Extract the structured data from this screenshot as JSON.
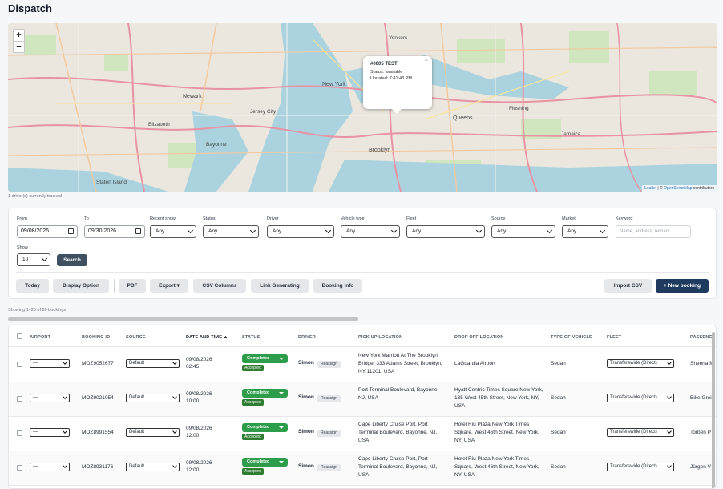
{
  "page": {
    "title": "Dispatch"
  },
  "map": {
    "zoom_in": "+",
    "zoom_out": "−",
    "popup": {
      "title": "#0005 TEST",
      "status": "Status: available",
      "updated": "Updated: 7:41:43 PM",
      "close": "×"
    },
    "labels": [
      "Newark",
      "Bayonne",
      "Elizabeth",
      "New York",
      "Brooklyn",
      "Queens",
      "Jersey City",
      "Yonkers",
      "Flushing",
      "Jamaica",
      "Staten Island"
    ],
    "attribution_prefix": "Leaflet",
    "attribution_sep": " | © ",
    "attribution_osm": "OpenStreetMap",
    "attribution_suffix": " contributors",
    "tracked_text": "1 driver(s) currently tracked"
  },
  "filters": {
    "from_label": "From",
    "from_value": "09/08/2026",
    "to_label": "To",
    "to_value": "09/30/2026",
    "recent_show_label": "Recent show",
    "recent_show_value": "Any",
    "status_label": "Status",
    "status_value": "Any",
    "driver_label": "Driver",
    "driver_value": "Any",
    "vehicle_type_label": "Vehicle type",
    "vehicle_type_value": "Any",
    "fleet_label": "Fleet",
    "fleet_value": "Any",
    "source_label": "Source",
    "source_value": "Any",
    "market_label": "Market",
    "market_value": "Any",
    "keyword_label": "Keyword",
    "keyword_placeholder": "Name, address, remark...",
    "show_label": "Show",
    "show_value": "10",
    "search_button": "Search"
  },
  "toolbar": {
    "today": "Today",
    "display_option": "Display Option",
    "pdf": "PDF",
    "export": "Export ▾",
    "csv_columns": "CSV Columns",
    "link_generating": "Link Generating",
    "booking_info": "Booking Info",
    "import_csv": "Import CSV",
    "new_booking": "+ New booking"
  },
  "showing_text": "Showing 1–25 of 89 bookings",
  "table": {
    "headers": {
      "airport": "AIRPORT",
      "booking_id": "BOOKING ID",
      "source": "SOURCE",
      "date_time": "DATE AND TIME ▲",
      "status": "STATUS",
      "driver": "DRIVER",
      "pickup": "PICK UP LOCATION",
      "dropoff": "DROP OFF LOCATION",
      "vehicle": "TYPE OF VEHICLE",
      "fleet": "FLEET",
      "passenger": "PASSENG"
    },
    "rows": [
      {
        "airport": "—",
        "id": "MOZ9052677",
        "source": "Default",
        "date": "09/08/2026",
        "time": "02:45",
        "status": "Completed",
        "sub": "Accepted",
        "driver": "Simon",
        "reassign": "Reassign",
        "pickup": "New York Marriott At The Brooklyn Bridge, 333 Adams Street, Brooklyn, NY 11201, USA",
        "dropoff": "LaGuardia Airport",
        "vehicle": "Sedan",
        "fleet": "Transferswide (Direct)",
        "passenger": "Sheena M"
      },
      {
        "airport": "—",
        "id": "MOZ9021054",
        "source": "Default",
        "date": "09/08/2026",
        "time": "10:00",
        "status": "Completed",
        "sub": "Accepted",
        "driver": "Simon",
        "reassign": "Reassign",
        "pickup": "Port Terminal Boulevard, Bayonne, NJ, USA",
        "dropoff": "Hyatt Centric Times Square New York, 135 West 45th Street, New York, NY, USA",
        "vehicle": "Sedan",
        "fleet": "Transferswide (Direct)",
        "passenger": "Eike Grei"
      },
      {
        "airport": "—",
        "id": "MOZ8991554",
        "source": "Default",
        "date": "09/08/2026",
        "time": "12:00",
        "status": "Completed",
        "sub": "Accepted",
        "driver": "Simon",
        "reassign": "Reassign",
        "pickup": "Cape Liberty Cruise Port, Port Terminal Boulevard, Bayonne, NJ, USA",
        "dropoff": "Hotel Riu Plaza New York Times Square, West 46th Street, New York, NY, USA",
        "vehicle": "Sedan",
        "fleet": "Transferswide (Direct)",
        "passenger": "Torben P"
      },
      {
        "airport": "—",
        "id": "MOZ8931176",
        "source": "Default",
        "date": "09/08/2026",
        "time": "12:00",
        "status": "Completed",
        "sub": "Accepted",
        "driver": "Simon",
        "reassign": "Reassign",
        "pickup": "Cape Liberty Cruise Port, Port Terminal Boulevard, Bayonne, NJ, USA",
        "dropoff": "Hotel Riu Plaza New York Times Square, West 46th Street, New York, NY, USA",
        "vehicle": "Sedan",
        "fleet": "Transferswide (Direct)",
        "passenger": "Jürgen V"
      }
    ]
  },
  "colors": {
    "status_green": "#2e9d4b",
    "primary_navy": "#1e3a5f",
    "search_slate": "#3f5161",
    "water": "#aad3df"
  }
}
